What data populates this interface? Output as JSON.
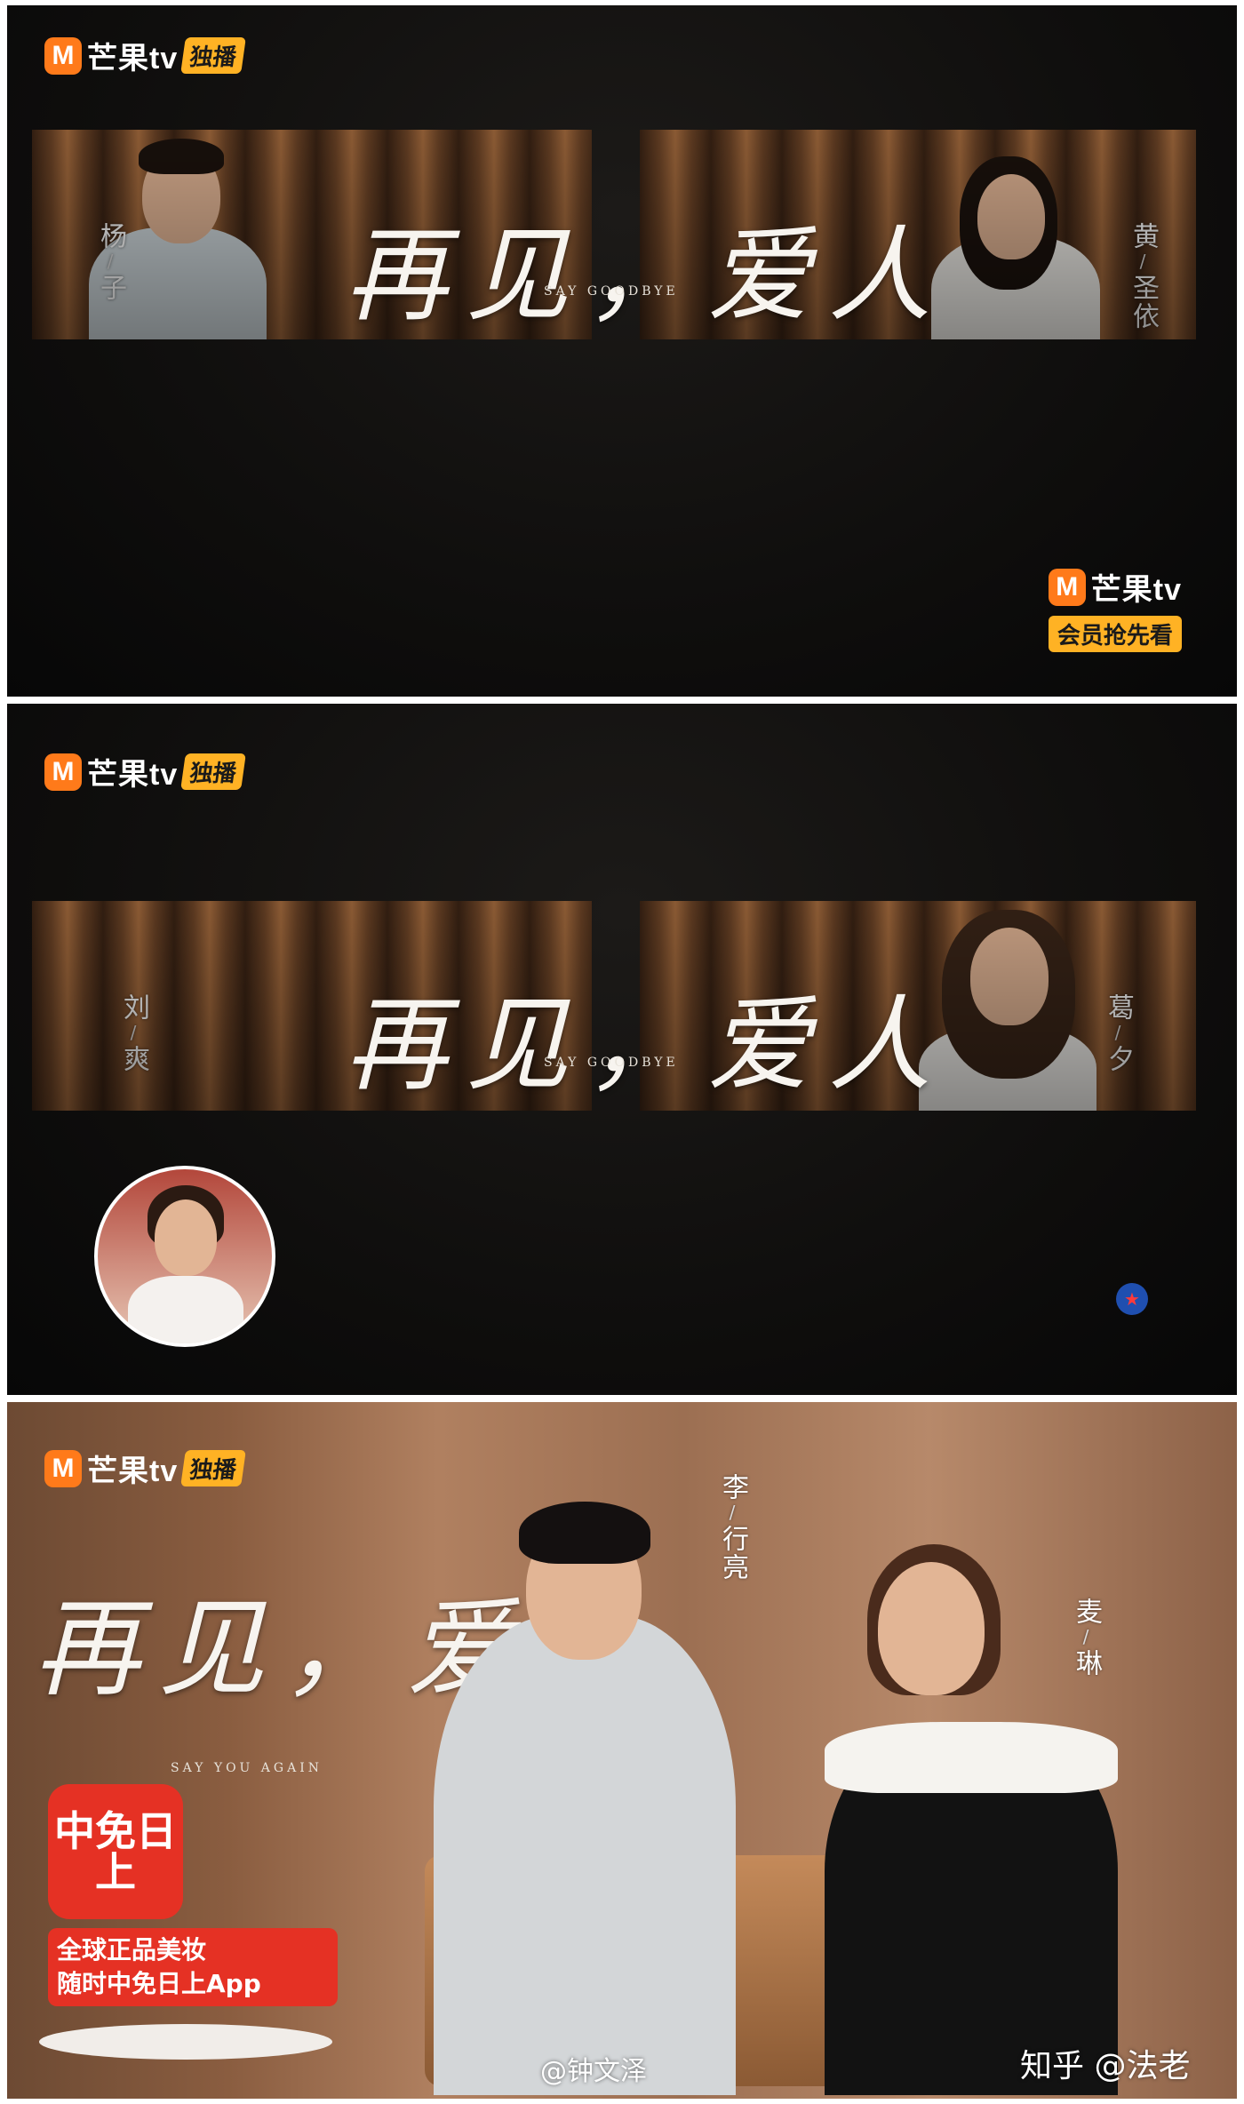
{
  "brand": {
    "name": "芒果tv",
    "exclusive_tag": "独播",
    "vip_tag": "会员抢先看"
  },
  "show": {
    "title": "再见，爱人",
    "subtitle_1": "SAY GOODBYE",
    "subtitle_3": "SAY YOU AGAIN"
  },
  "panels": [
    {
      "left_name": [
        "杨",
        "子"
      ],
      "right_name": [
        "黄",
        "圣依"
      ]
    },
    {
      "left_name": [
        "刘",
        "爽"
      ],
      "right_name": [
        "葛",
        "夕"
      ]
    },
    {
      "left_name": [
        "李",
        "行亮"
      ],
      "right_name": [
        "麦",
        "琳"
      ]
    }
  ],
  "ad": {
    "logo_text": "中免日上",
    "line1": "全球正品美妆",
    "line2": "随时中免日上App"
  },
  "watermarks": {
    "weibo": "@钟文泽",
    "zhihu": "知乎 @法老"
  }
}
